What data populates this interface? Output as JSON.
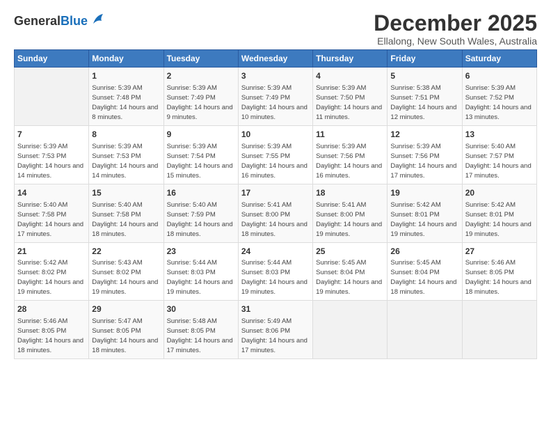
{
  "logo": {
    "general": "General",
    "blue": "Blue"
  },
  "title": "December 2025",
  "subtitle": "Ellalong, New South Wales, Australia",
  "headers": [
    "Sunday",
    "Monday",
    "Tuesday",
    "Wednesday",
    "Thursday",
    "Friday",
    "Saturday"
  ],
  "weeks": [
    [
      {
        "day": "",
        "sunrise": "",
        "sunset": "",
        "daylight": ""
      },
      {
        "day": "1",
        "sunrise": "Sunrise: 5:39 AM",
        "sunset": "Sunset: 7:48 PM",
        "daylight": "Daylight: 14 hours and 8 minutes."
      },
      {
        "day": "2",
        "sunrise": "Sunrise: 5:39 AM",
        "sunset": "Sunset: 7:49 PM",
        "daylight": "Daylight: 14 hours and 9 minutes."
      },
      {
        "day": "3",
        "sunrise": "Sunrise: 5:39 AM",
        "sunset": "Sunset: 7:49 PM",
        "daylight": "Daylight: 14 hours and 10 minutes."
      },
      {
        "day": "4",
        "sunrise": "Sunrise: 5:39 AM",
        "sunset": "Sunset: 7:50 PM",
        "daylight": "Daylight: 14 hours and 11 minutes."
      },
      {
        "day": "5",
        "sunrise": "Sunrise: 5:38 AM",
        "sunset": "Sunset: 7:51 PM",
        "daylight": "Daylight: 14 hours and 12 minutes."
      },
      {
        "day": "6",
        "sunrise": "Sunrise: 5:39 AM",
        "sunset": "Sunset: 7:52 PM",
        "daylight": "Daylight: 14 hours and 13 minutes."
      }
    ],
    [
      {
        "day": "7",
        "sunrise": "Sunrise: 5:39 AM",
        "sunset": "Sunset: 7:53 PM",
        "daylight": "Daylight: 14 hours and 14 minutes."
      },
      {
        "day": "8",
        "sunrise": "Sunrise: 5:39 AM",
        "sunset": "Sunset: 7:53 PM",
        "daylight": "Daylight: 14 hours and 14 minutes."
      },
      {
        "day": "9",
        "sunrise": "Sunrise: 5:39 AM",
        "sunset": "Sunset: 7:54 PM",
        "daylight": "Daylight: 14 hours and 15 minutes."
      },
      {
        "day": "10",
        "sunrise": "Sunrise: 5:39 AM",
        "sunset": "Sunset: 7:55 PM",
        "daylight": "Daylight: 14 hours and 16 minutes."
      },
      {
        "day": "11",
        "sunrise": "Sunrise: 5:39 AM",
        "sunset": "Sunset: 7:56 PM",
        "daylight": "Daylight: 14 hours and 16 minutes."
      },
      {
        "day": "12",
        "sunrise": "Sunrise: 5:39 AM",
        "sunset": "Sunset: 7:56 PM",
        "daylight": "Daylight: 14 hours and 17 minutes."
      },
      {
        "day": "13",
        "sunrise": "Sunrise: 5:40 AM",
        "sunset": "Sunset: 7:57 PM",
        "daylight": "Daylight: 14 hours and 17 minutes."
      }
    ],
    [
      {
        "day": "14",
        "sunrise": "Sunrise: 5:40 AM",
        "sunset": "Sunset: 7:58 PM",
        "daylight": "Daylight: 14 hours and 17 minutes."
      },
      {
        "day": "15",
        "sunrise": "Sunrise: 5:40 AM",
        "sunset": "Sunset: 7:58 PM",
        "daylight": "Daylight: 14 hours and 18 minutes."
      },
      {
        "day": "16",
        "sunrise": "Sunrise: 5:40 AM",
        "sunset": "Sunset: 7:59 PM",
        "daylight": "Daylight: 14 hours and 18 minutes."
      },
      {
        "day": "17",
        "sunrise": "Sunrise: 5:41 AM",
        "sunset": "Sunset: 8:00 PM",
        "daylight": "Daylight: 14 hours and 18 minutes."
      },
      {
        "day": "18",
        "sunrise": "Sunrise: 5:41 AM",
        "sunset": "Sunset: 8:00 PM",
        "daylight": "Daylight: 14 hours and 19 minutes."
      },
      {
        "day": "19",
        "sunrise": "Sunrise: 5:42 AM",
        "sunset": "Sunset: 8:01 PM",
        "daylight": "Daylight: 14 hours and 19 minutes."
      },
      {
        "day": "20",
        "sunrise": "Sunrise: 5:42 AM",
        "sunset": "Sunset: 8:01 PM",
        "daylight": "Daylight: 14 hours and 19 minutes."
      }
    ],
    [
      {
        "day": "21",
        "sunrise": "Sunrise: 5:42 AM",
        "sunset": "Sunset: 8:02 PM",
        "daylight": "Daylight: 14 hours and 19 minutes."
      },
      {
        "day": "22",
        "sunrise": "Sunrise: 5:43 AM",
        "sunset": "Sunset: 8:02 PM",
        "daylight": "Daylight: 14 hours and 19 minutes."
      },
      {
        "day": "23",
        "sunrise": "Sunrise: 5:44 AM",
        "sunset": "Sunset: 8:03 PM",
        "daylight": "Daylight: 14 hours and 19 minutes."
      },
      {
        "day": "24",
        "sunrise": "Sunrise: 5:44 AM",
        "sunset": "Sunset: 8:03 PM",
        "daylight": "Daylight: 14 hours and 19 minutes."
      },
      {
        "day": "25",
        "sunrise": "Sunrise: 5:45 AM",
        "sunset": "Sunset: 8:04 PM",
        "daylight": "Daylight: 14 hours and 19 minutes."
      },
      {
        "day": "26",
        "sunrise": "Sunrise: 5:45 AM",
        "sunset": "Sunset: 8:04 PM",
        "daylight": "Daylight: 14 hours and 18 minutes."
      },
      {
        "day": "27",
        "sunrise": "Sunrise: 5:46 AM",
        "sunset": "Sunset: 8:05 PM",
        "daylight": "Daylight: 14 hours and 18 minutes."
      }
    ],
    [
      {
        "day": "28",
        "sunrise": "Sunrise: 5:46 AM",
        "sunset": "Sunset: 8:05 PM",
        "daylight": "Daylight: 14 hours and 18 minutes."
      },
      {
        "day": "29",
        "sunrise": "Sunrise: 5:47 AM",
        "sunset": "Sunset: 8:05 PM",
        "daylight": "Daylight: 14 hours and 18 minutes."
      },
      {
        "day": "30",
        "sunrise": "Sunrise: 5:48 AM",
        "sunset": "Sunset: 8:05 PM",
        "daylight": "Daylight: 14 hours and 17 minutes."
      },
      {
        "day": "31",
        "sunrise": "Sunrise: 5:49 AM",
        "sunset": "Sunset: 8:06 PM",
        "daylight": "Daylight: 14 hours and 17 minutes."
      },
      {
        "day": "",
        "sunrise": "",
        "sunset": "",
        "daylight": ""
      },
      {
        "day": "",
        "sunrise": "",
        "sunset": "",
        "daylight": ""
      },
      {
        "day": "",
        "sunrise": "",
        "sunset": "",
        "daylight": ""
      }
    ]
  ]
}
